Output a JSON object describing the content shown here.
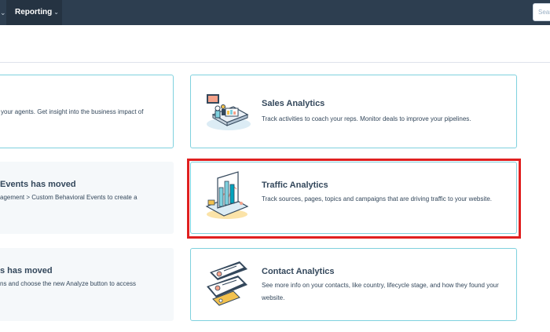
{
  "nav": {
    "prev_caret": "⌄",
    "reporting_label": "Reporting",
    "reporting_caret": "⌄",
    "search_placeholder": "Search"
  },
  "left_cards": [
    {
      "title": "",
      "description": "your agents. Get insight into the business impact of"
    },
    {
      "title": "Events has moved",
      "description": "agement > Custom Behavioral Events to create a"
    },
    {
      "title": "s has moved",
      "description": "ns and choose the new Analyze button to access"
    }
  ],
  "right_cards": [
    {
      "title": "Sales Analytics",
      "description": "Track activities to coach your reps. Monitor deals to improve your pipelines.",
      "icon": "sales-analytics-illustration"
    },
    {
      "title": "Traffic Analytics",
      "description": "Track sources, pages, topics and campaigns that are driving traffic to your website.",
      "icon": "traffic-analytics-illustration"
    },
    {
      "title": "Contact Analytics",
      "description": "See more info on your contacts, like country, lifecycle stage, and how they found your website.",
      "icon": "contact-analytics-illustration"
    }
  ],
  "colors": {
    "nav_bg": "#2d3e50",
    "card_border": "#7fd1de",
    "highlight": "#e02020",
    "text": "#33475b"
  }
}
